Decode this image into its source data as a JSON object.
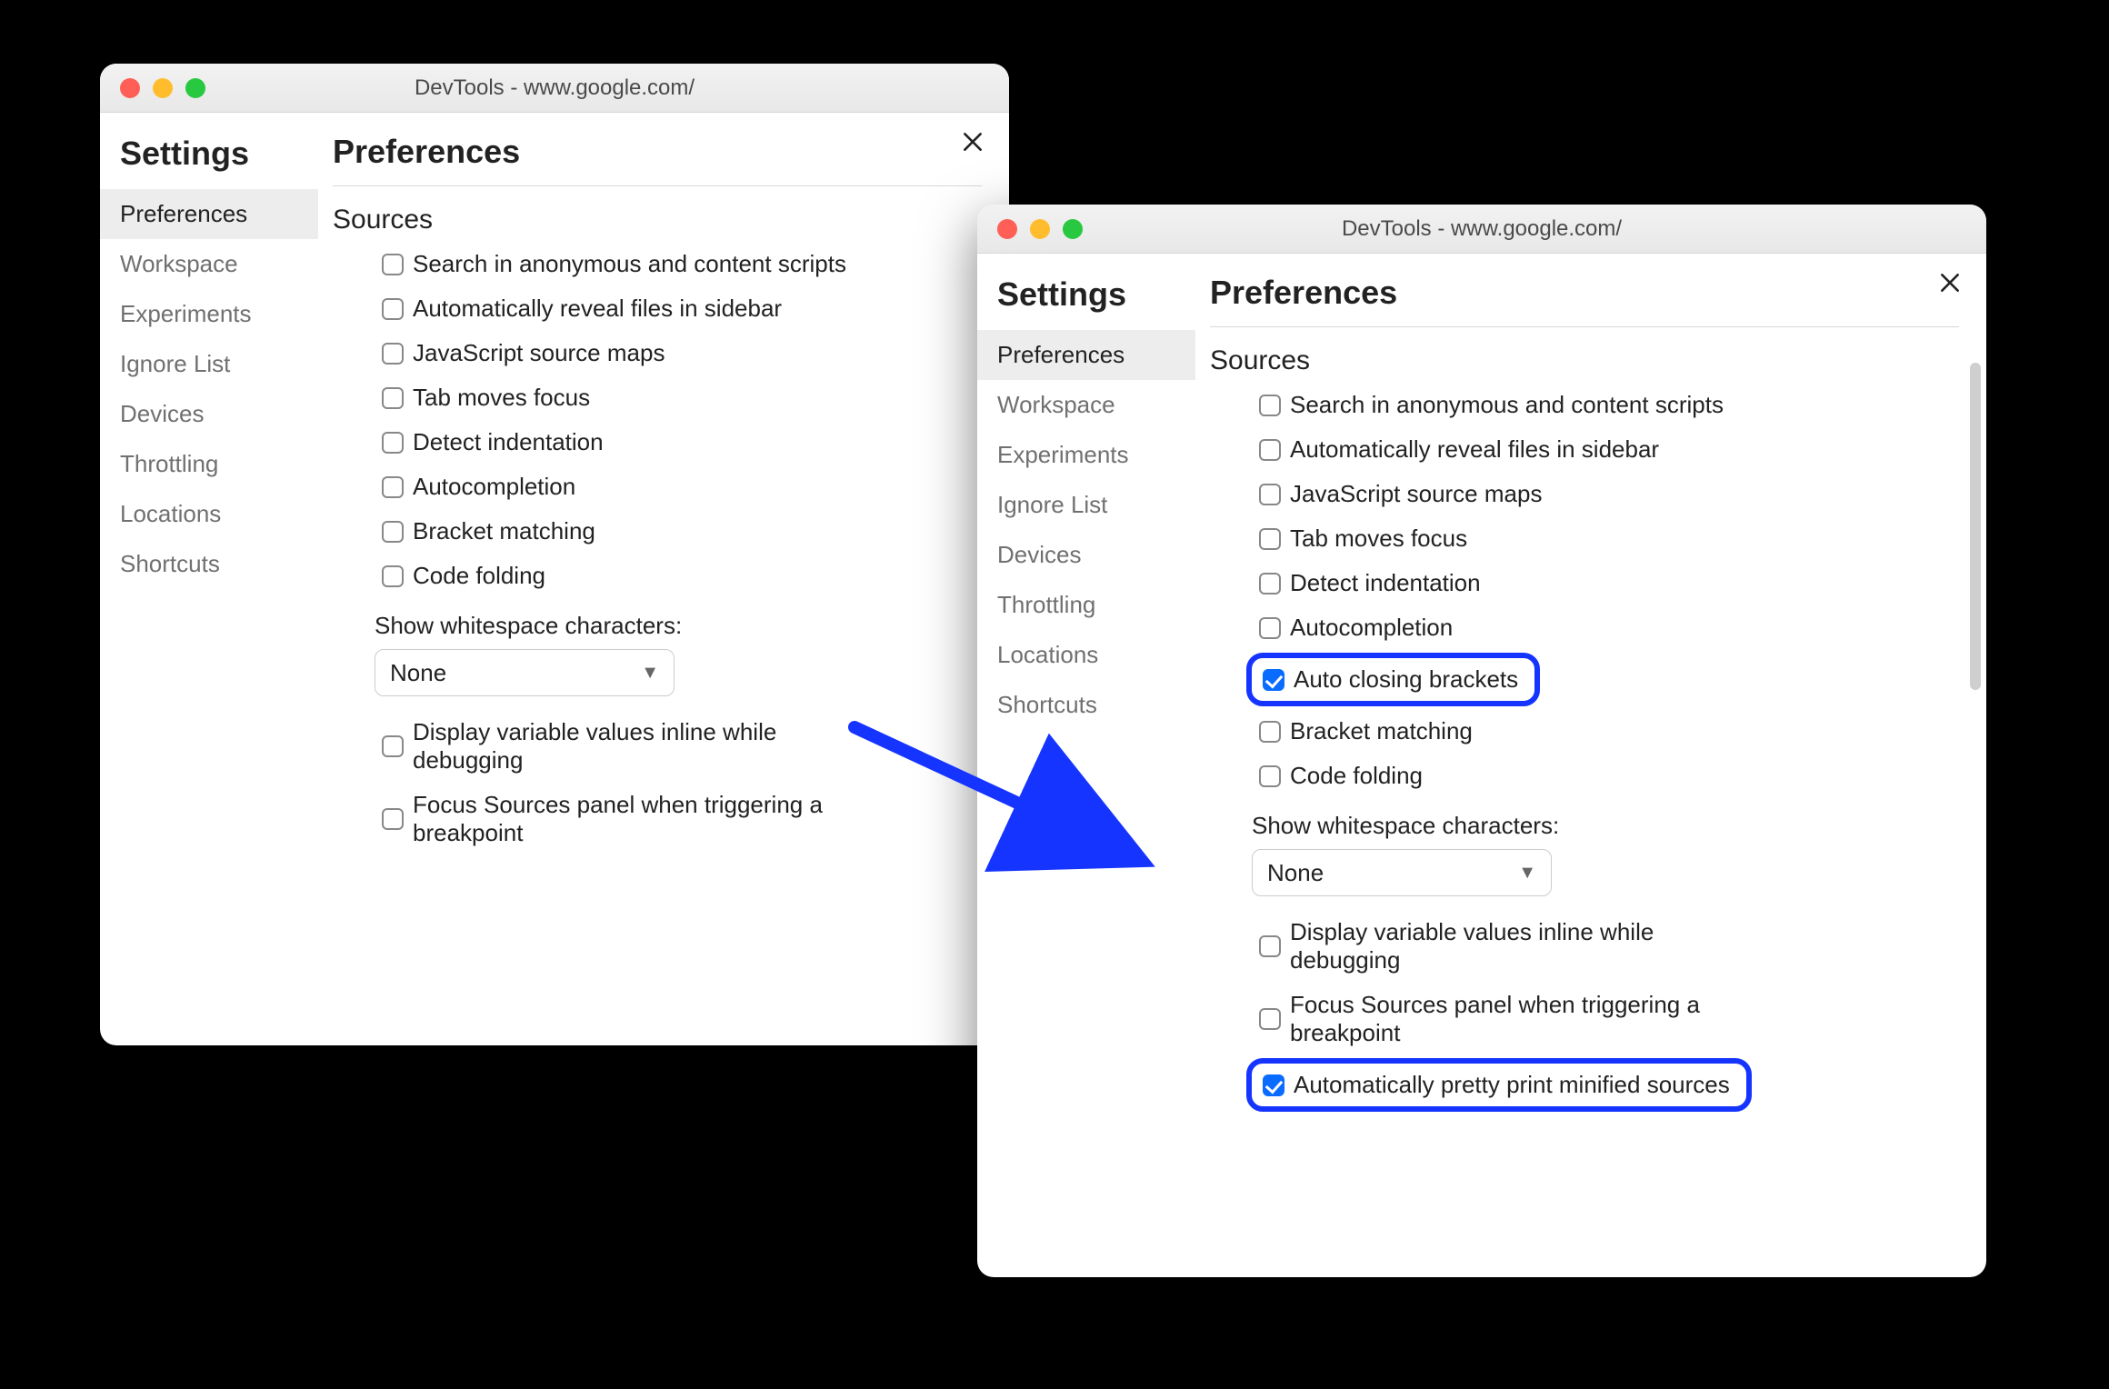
{
  "colors": {
    "accent_blue": "#0a6cff",
    "highlight_border": "#1534ff"
  },
  "windowA": {
    "title": "DevTools - www.google.com/",
    "settings_heading": "Settings",
    "close_icon_name": "close-icon",
    "sidebar": {
      "items": [
        {
          "label": "Preferences",
          "active": true
        },
        {
          "label": "Workspace",
          "active": false
        },
        {
          "label": "Experiments",
          "active": false
        },
        {
          "label": "Ignore List",
          "active": false
        },
        {
          "label": "Devices",
          "active": false
        },
        {
          "label": "Throttling",
          "active": false
        },
        {
          "label": "Locations",
          "active": false
        },
        {
          "label": "Shortcuts",
          "active": false
        }
      ]
    },
    "main": {
      "title": "Preferences",
      "section": "Sources",
      "options": [
        {
          "label": "Search in anonymous and content scripts",
          "checked": false,
          "highlight": false
        },
        {
          "label": "Automatically reveal files in sidebar",
          "checked": false,
          "highlight": false
        },
        {
          "label": "JavaScript source maps",
          "checked": false,
          "highlight": false
        },
        {
          "label": "Tab moves focus",
          "checked": false,
          "highlight": false
        },
        {
          "label": "Detect indentation",
          "checked": false,
          "highlight": false
        },
        {
          "label": "Autocompletion",
          "checked": false,
          "highlight": false
        },
        {
          "label": "Bracket matching",
          "checked": false,
          "highlight": false
        },
        {
          "label": "Code folding",
          "checked": false,
          "highlight": false
        }
      ],
      "whitespace_label": "Show whitespace characters:",
      "whitespace_value": "None",
      "options2": [
        {
          "label": "Display variable values inline while debugging",
          "checked": false,
          "highlight": false
        },
        {
          "label": "Focus Sources panel when triggering a breakpoint",
          "checked": false,
          "highlight": false
        }
      ]
    }
  },
  "windowB": {
    "title": "DevTools - www.google.com/",
    "settings_heading": "Settings",
    "close_icon_name": "close-icon",
    "sidebar": {
      "items": [
        {
          "label": "Preferences",
          "active": true
        },
        {
          "label": "Workspace",
          "active": false
        },
        {
          "label": "Experiments",
          "active": false
        },
        {
          "label": "Ignore List",
          "active": false
        },
        {
          "label": "Devices",
          "active": false
        },
        {
          "label": "Throttling",
          "active": false
        },
        {
          "label": "Locations",
          "active": false
        },
        {
          "label": "Shortcuts",
          "active": false
        }
      ]
    },
    "main": {
      "title": "Preferences",
      "section": "Sources",
      "options": [
        {
          "label": "Search in anonymous and content scripts",
          "checked": false,
          "highlight": false
        },
        {
          "label": "Automatically reveal files in sidebar",
          "checked": false,
          "highlight": false
        },
        {
          "label": "JavaScript source maps",
          "checked": false,
          "highlight": false
        },
        {
          "label": "Tab moves focus",
          "checked": false,
          "highlight": false
        },
        {
          "label": "Detect indentation",
          "checked": false,
          "highlight": false
        },
        {
          "label": "Autocompletion",
          "checked": false,
          "highlight": false
        },
        {
          "label": "Auto closing brackets",
          "checked": true,
          "highlight": true
        },
        {
          "label": "Bracket matching",
          "checked": false,
          "highlight": false
        },
        {
          "label": "Code folding",
          "checked": false,
          "highlight": false
        }
      ],
      "whitespace_label": "Show whitespace characters:",
      "whitespace_value": "None",
      "options2": [
        {
          "label": "Display variable values inline while debugging",
          "checked": false,
          "highlight": false
        },
        {
          "label": "Focus Sources panel when triggering a breakpoint",
          "checked": false,
          "highlight": false
        },
        {
          "label": "Automatically pretty print minified sources",
          "checked": true,
          "highlight": true
        }
      ]
    }
  }
}
